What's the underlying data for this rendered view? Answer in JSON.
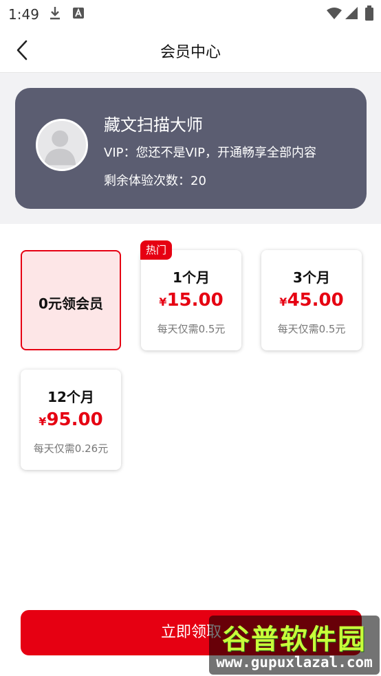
{
  "status_bar": {
    "time": "1:49",
    "icons": [
      "download-icon",
      "a-icon",
      "wifi-icon",
      "signal-icon",
      "battery-icon"
    ]
  },
  "header": {
    "back_icon": "chevron-left-icon",
    "title": "会员中心"
  },
  "profile": {
    "avatar_icon": "user-avatar-icon",
    "name": "藏文扫描大师",
    "vip_status": "VIP：您还不是VIP，开通畅享全部内容",
    "trial_remaining": "剩余体验次数：20"
  },
  "plans": [
    {
      "label": "0元领会员",
      "selected": true
    },
    {
      "badge": "热门",
      "name": "1个月",
      "currency": "¥",
      "price": "15.00",
      "daily": "每天仅需0.5元"
    },
    {
      "name": "3个月",
      "currency": "¥",
      "price": "45.00",
      "daily": "每天仅需0.5元"
    },
    {
      "name": "12个月",
      "currency": "¥",
      "price": "95.00",
      "daily": "每天仅需0.26元"
    }
  ],
  "cta": {
    "label": "立即领取"
  },
  "watermark": {
    "cn": "谷普软件园",
    "en": "www.gupuxlazal.com"
  },
  "colors": {
    "accent": "#e60012",
    "card_bg": "#5b5d71",
    "selected_bg": "#fde6e7"
  }
}
